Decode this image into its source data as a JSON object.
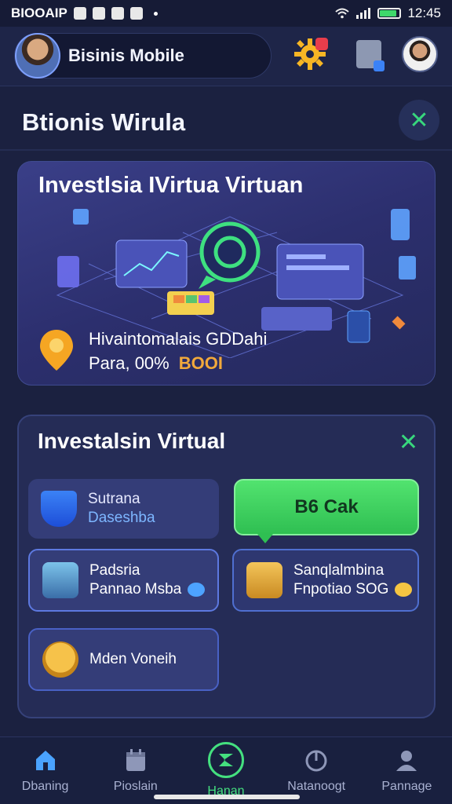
{
  "status_bar": {
    "carrier": "BIOOAIP",
    "time": "12:45"
  },
  "header": {
    "app_name": "Bisinis Mobile"
  },
  "section": {
    "title": "Btionis Wirula"
  },
  "hero": {
    "title": "Investlsia IVirtua  Virtuan",
    "subtitle": "Hivaintomalais GDDahi",
    "line2_prefix": "Para, 00%",
    "amount": "BOOI"
  },
  "panel": {
    "title": "Investalsin Virtual",
    "tiles": [
      {
        "line1": "Sutrana",
        "line2": "Daseshba"
      },
      {
        "line1": "Padsria",
        "line2": "Pannao Msba"
      },
      {
        "line1": "Sanqlalmbina",
        "line2": "Fnpotiao SOG"
      },
      {
        "line1": "Mden Voneih",
        "line2": ""
      }
    ],
    "cta_label": "B6 Cak"
  },
  "bottom_nav": {
    "items": [
      {
        "label": "Dbaning",
        "icon": "home-icon"
      },
      {
        "label": "Pioslain",
        "icon": "calendar-icon"
      },
      {
        "label": "Hanan",
        "icon": "exchange-icon"
      },
      {
        "label": "Natanoogt",
        "icon": "power-icon"
      },
      {
        "label": "Pannage",
        "icon": "user-icon"
      }
    ],
    "active_index": 2
  },
  "colors": {
    "accent_green": "#44e07f",
    "background": "#1b2140",
    "amount_orange": "#f2a93b"
  }
}
